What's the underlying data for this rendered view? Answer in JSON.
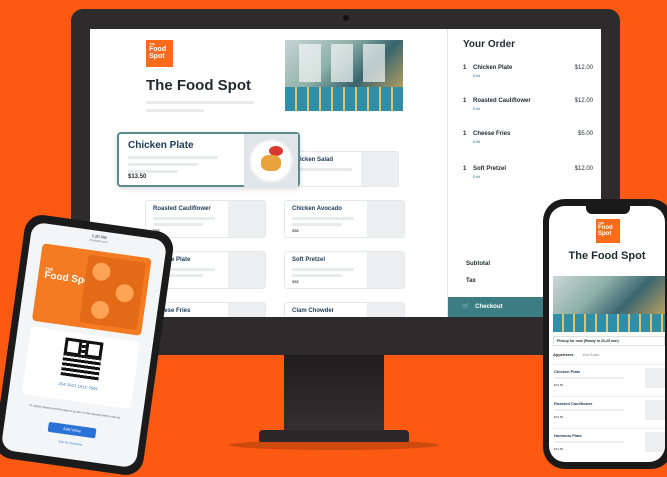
{
  "desktop": {
    "brand": {
      "logo_the": "THE",
      "logo_name": "Food Spot",
      "title": "The Food Spot"
    },
    "featured": {
      "name": "Chicken Plate",
      "price": "$13.50"
    },
    "menu_items": [
      {
        "name": "Chicken Salad",
        "price": ""
      },
      {
        "name": "Roasted Cauliflower",
        "price": "$$$"
      },
      {
        "name": "Chicken Avocado",
        "price": "$$$"
      },
      {
        "name": "Cheese Plate",
        "price": "$$$"
      },
      {
        "name": "Soft Pretzel",
        "price": "$$$"
      },
      {
        "name": "Cheese Fries",
        "price": ""
      },
      {
        "name": "Clam Chowder",
        "price": ""
      }
    ],
    "order": {
      "title": "Your Order",
      "items": [
        {
          "qty": "1",
          "name": "Chicken Plate",
          "price": "$12.00",
          "edit": "Edit"
        },
        {
          "qty": "1",
          "name": "Roasted Cauliflower",
          "price": "$12.00",
          "edit": "Edit"
        },
        {
          "qty": "1",
          "name": "Cheese Fries",
          "price": "$5.00",
          "edit": "Edit"
        },
        {
          "qty": "1",
          "name": "Soft Pretzel",
          "price": "$12.00",
          "edit": "Edit"
        }
      ],
      "subtotal_label": "Subtotal",
      "tax_label": "Tax",
      "checkout_label": "Checkout"
    }
  },
  "left_phone": {
    "time": "1:20 PM",
    "url": "foodspot.com",
    "flyer_the": "THE",
    "flyer_name": "Food Spot",
    "code": "JD4 2FG1 1A1C 2S91",
    "hint": "To register please point the page to product in the selected shelf on the list",
    "button": "Add Value",
    "link": "Skip for Tomorrow"
  },
  "right_phone": {
    "logo_the": "THE",
    "logo_name": "Food Spot",
    "title": "The Food Spot",
    "pickup": "Pickup for now (Ready in 20-25 min)",
    "tabs": [
      "Appetizers",
      "Hot Subs"
    ],
    "items": [
      {
        "name": "Chicken Plate",
        "price": "$13.50"
      },
      {
        "name": "Roasted Cauliflower",
        "price": "$13.50"
      },
      {
        "name": "Hummus Plate",
        "price": "$13.50"
      }
    ]
  },
  "colors": {
    "background": "#fc5a12",
    "brand": "#fc6b1a",
    "accent": "#3b7d82",
    "link": "#2b72d7"
  }
}
